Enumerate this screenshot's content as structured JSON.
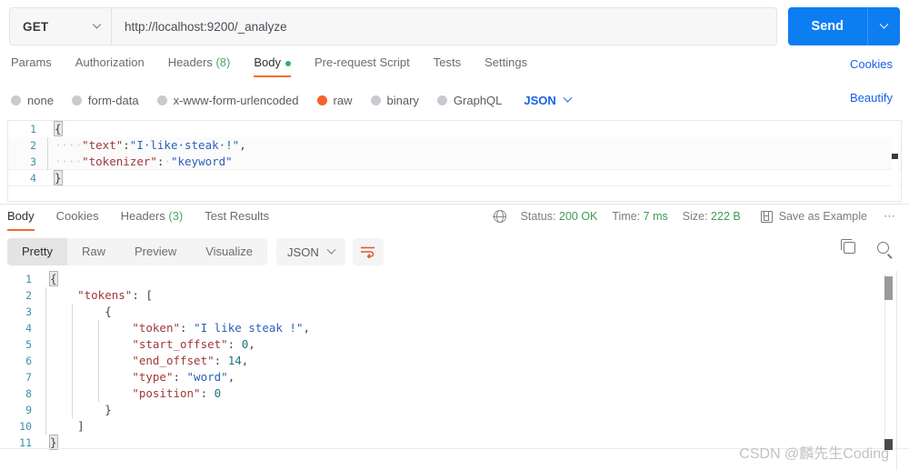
{
  "request": {
    "method": "GET",
    "url": "http://localhost:9200/_analyze",
    "send_label": "Send",
    "tabs": [
      {
        "label": "Params",
        "active": false
      },
      {
        "label": "Authorization",
        "active": false
      },
      {
        "label": "Headers",
        "count": "(8)",
        "active": false
      },
      {
        "label": "Body",
        "active": true,
        "dot": true
      },
      {
        "label": "Pre-request Script",
        "active": false
      },
      {
        "label": "Tests",
        "active": false
      },
      {
        "label": "Settings",
        "active": false
      }
    ],
    "cookies_link": "Cookies",
    "beautify_link": "Beautify",
    "body_types": [
      {
        "label": "none",
        "selected": false
      },
      {
        "label": "form-data",
        "selected": false
      },
      {
        "label": "x-www-form-urlencoded",
        "selected": false
      },
      {
        "label": "raw",
        "selected": true
      },
      {
        "label": "binary",
        "selected": false
      },
      {
        "label": "GraphQL",
        "selected": false
      }
    ],
    "format": "JSON",
    "body_lines": [
      {
        "n": "1",
        "text": "{"
      },
      {
        "n": "2",
        "text": "    \"text\":\"I like steak !\","
      },
      {
        "n": "3",
        "text": "    \"tokenizer\": \"keyword\""
      },
      {
        "n": "4",
        "text": "}"
      }
    ]
  },
  "response": {
    "tabs": [
      {
        "label": "Body",
        "active": true
      },
      {
        "label": "Cookies",
        "active": false
      },
      {
        "label": "Headers",
        "count": "(3)",
        "active": false
      },
      {
        "label": "Test Results",
        "active": false
      }
    ],
    "status_label": "Status:",
    "status_value": "200 OK",
    "time_label": "Time:",
    "time_value": "7 ms",
    "size_label": "Size:",
    "size_value": "222 B",
    "save_example": "Save as Example",
    "more": "⋯",
    "views": [
      {
        "label": "Pretty",
        "active": true
      },
      {
        "label": "Raw",
        "active": false
      },
      {
        "label": "Preview",
        "active": false
      },
      {
        "label": "Visualize",
        "active": false
      }
    ],
    "format": "JSON",
    "body_lines": [
      {
        "n": "1",
        "text": "{"
      },
      {
        "n": "2",
        "text": "    \"tokens\": ["
      },
      {
        "n": "3",
        "text": "        {"
      },
      {
        "n": "4",
        "text": "            \"token\": \"I like steak !\","
      },
      {
        "n": "5",
        "text": "            \"start_offset\": 0,"
      },
      {
        "n": "6",
        "text": "            \"end_offset\": 14,"
      },
      {
        "n": "7",
        "text": "            \"type\": \"word\","
      },
      {
        "n": "8",
        "text": "            \"position\": 0"
      },
      {
        "n": "9",
        "text": "        }"
      },
      {
        "n": "10",
        "text": "    ]"
      },
      {
        "n": "11",
        "text": "}"
      }
    ]
  },
  "watermark": "CSDN @麟先生Coding",
  "colors": {
    "accent_blue": "#0d7df2",
    "tab_underline": "#ef6c2e",
    "status_green": "#3f9c52",
    "radio_on": "#f8622a"
  }
}
